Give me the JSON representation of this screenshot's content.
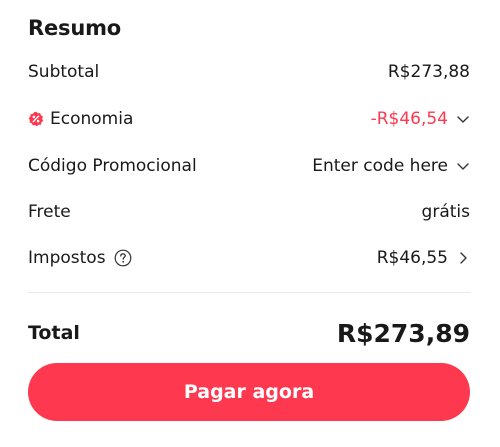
{
  "summary": {
    "title": "Resumo",
    "subtotal_label": "Subtotal",
    "subtotal_value": "R$273,88",
    "savings_label": "Economia",
    "savings_value": "-R$46,54",
    "promo_label": "Código Promocional",
    "promo_value": "Enter code here",
    "shipping_label": "Frete",
    "shipping_value": "grátis",
    "taxes_label": "Impostos",
    "taxes_value": "R$46,55",
    "total_label": "Total",
    "total_value": "R$273,89",
    "pay_button_label": "Pagar agora"
  },
  "colors": {
    "accent": "#fd384f",
    "text": "#191919",
    "divider": "#e8e8e8"
  },
  "icons": {
    "savings": "discount-badge-icon",
    "help": "question-circle-icon",
    "expand": "chevron-down-icon",
    "navigate": "chevron-right-icon"
  }
}
